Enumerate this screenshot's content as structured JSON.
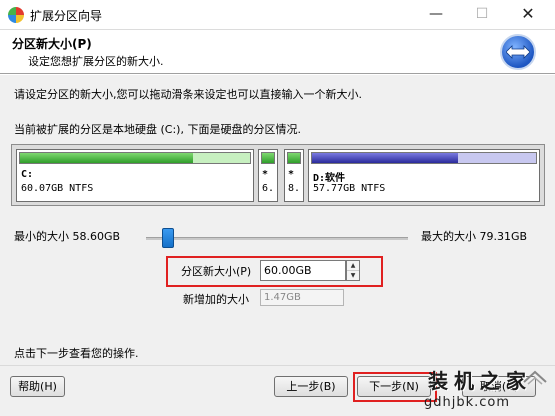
{
  "window": {
    "title": "扩展分区向导",
    "minimize_glyph": "—",
    "maximize_glyph": "☐",
    "close_glyph": "✕"
  },
  "header": {
    "title": "分区新大小(P)",
    "subtitle": "设定您想扩展分区的新大小."
  },
  "main": {
    "instruction": "请设定分区的新大小,您可以拖动滑条来设定也可以直接输入一个新大小.",
    "disk_info": "当前被扩展的分区是本地硬盘 (C:), 下面是硬盘的分区情况.",
    "partitions": [
      {
        "label": "C:",
        "size": "60.07GB NTFS",
        "used_fraction": 0.75,
        "color": "green"
      },
      {
        "label": "*",
        "size": "6.",
        "used_fraction": 1.0,
        "color": "green"
      },
      {
        "label": "*",
        "size": "8.",
        "used_fraction": 1.0,
        "color": "green"
      },
      {
        "label": "D:软件",
        "size": "57.77GB NTFS",
        "used_fraction": 0.65,
        "color": "blue"
      }
    ],
    "min_size_label": "最小的大小 58.60GB",
    "max_size_label": "最大的大小 79.31GB",
    "slider_value_gb": 60.0,
    "new_size_label": "分区新大小(P)",
    "new_size_value": "60.00GB",
    "added_size_label": "新增加的大小",
    "added_size_value": "1.47GB",
    "hint": "点击下一步查看您的操作."
  },
  "footer": {
    "help_label": "帮助(H)",
    "back_label": "上一步(B)",
    "next_label": "下一步(N)",
    "cancel_label": "取消(C)"
  },
  "watermark": {
    "title": "装机之家",
    "url": "gdhjbk.com"
  },
  "colors": {
    "highlight_red": "#e02020",
    "partition_green": "#2f9e2a",
    "partition_blue": "#2a2a9a",
    "slider_blue": "#1570c8"
  }
}
